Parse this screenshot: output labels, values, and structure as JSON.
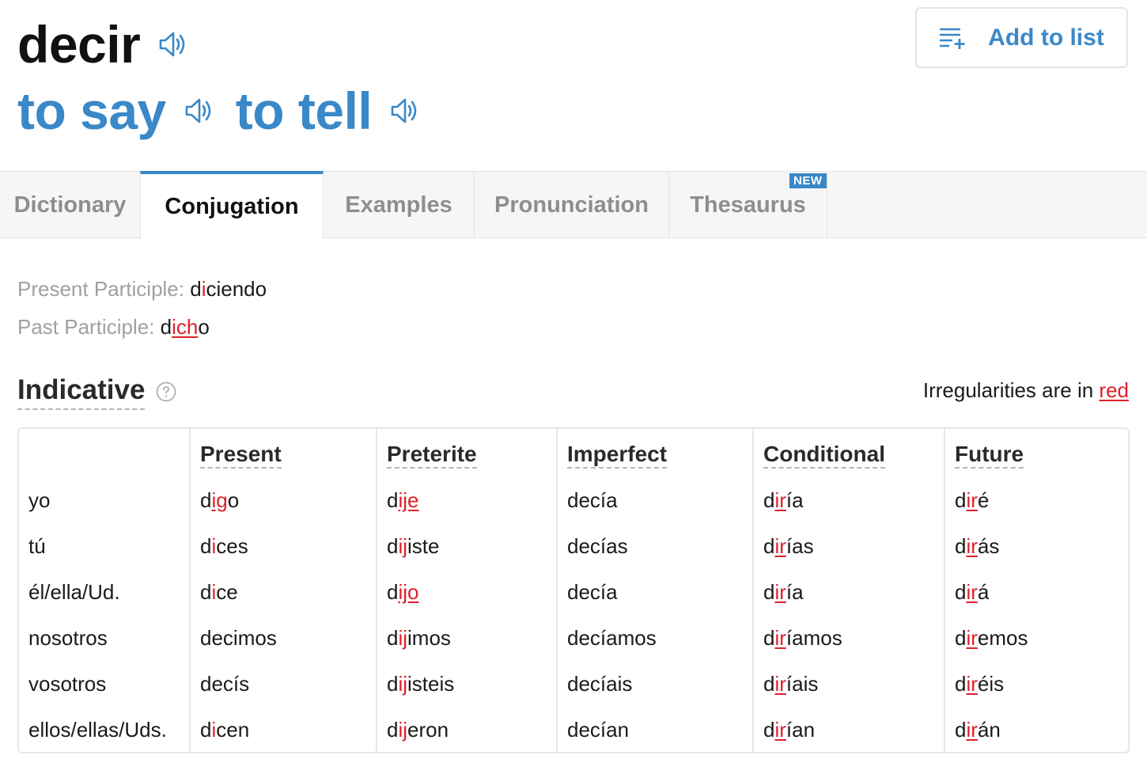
{
  "header": {
    "headword": "decir",
    "translations": [
      "to say",
      "to tell"
    ],
    "add_to_list": "Add to list"
  },
  "icons": {
    "audio": "speaker-icon",
    "add_list": "playlist-add-icon",
    "help": "question-circle-icon"
  },
  "tabs": [
    {
      "label": "Dictionary",
      "active": false
    },
    {
      "label": "Conjugation",
      "active": true
    },
    {
      "label": "Examples",
      "active": false
    },
    {
      "label": "Pronunciation",
      "active": false
    },
    {
      "label": "Thesaurus",
      "active": false,
      "badge": "NEW"
    }
  ],
  "participles": {
    "present_label": "Present Participle:",
    "present_value": "diciendo",
    "past_label": "Past Participle:",
    "past_value": "dicho"
  },
  "indicative": {
    "title": "Indicative",
    "legend_prefix": "Irregularities are in",
    "legend_red": "red",
    "columns": [
      "Present",
      "Preterite",
      "Imperfect",
      "Conditional",
      "Future"
    ],
    "rows": [
      {
        "pronoun": "yo",
        "forms": [
          "digo",
          "dije",
          "decía",
          "diría",
          "diré"
        ]
      },
      {
        "pronoun": "tú",
        "forms": [
          "dices",
          "dijiste",
          "decías",
          "dirías",
          "dirás"
        ]
      },
      {
        "pronoun": "él/ella/Ud.",
        "forms": [
          "dice",
          "dijo",
          "decía",
          "diría",
          "dirá"
        ]
      },
      {
        "pronoun": "nosotros",
        "forms": [
          "decimos",
          "dijimos",
          "decíamos",
          "diríamos",
          "diremos"
        ]
      },
      {
        "pronoun": "vosotros",
        "forms": [
          "decís",
          "dijisteis",
          "decíais",
          "diríais",
          "diréis"
        ]
      },
      {
        "pronoun": "ellos/ellas/Uds.",
        "forms": [
          "dicen",
          "dijeron",
          "decían",
          "dirían",
          "dirán"
        ]
      }
    ]
  },
  "colors": {
    "brand_blue": "#3a88c8",
    "irregular_red": "#e0202a",
    "muted_label": "#a0a0a0"
  }
}
